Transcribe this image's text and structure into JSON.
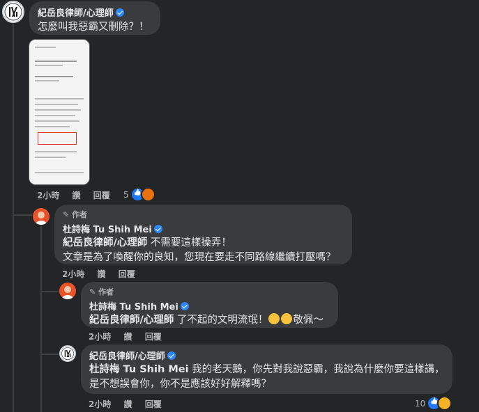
{
  "thread": {
    "top_comment": {
      "name": "紀岳良律師/心理師",
      "text": "怎麼叫我惡霸又刪除？！",
      "time": "2小時",
      "like_label": "讚",
      "reply_label": "回覆",
      "reaction_count": "5"
    },
    "reply1": {
      "author_badge": "作者",
      "name": "杜詩梅 Tu Shih Mei",
      "mention": "紀岳良律師/心理師",
      "line1_rest": " 不需要這樣操弄！",
      "line2": "文章是為了喚醒你的良知，您現在要走不同路線繼續打壓嗎？",
      "time": "2小時",
      "like_label": "讚",
      "reply_label": "回覆"
    },
    "reply2": {
      "author_badge": "作者",
      "name": "杜詩梅 Tu Shih Mei",
      "mention": "紀岳良律師/心理師",
      "text_before_emoji": " 了不起的文明流氓！",
      "text_after_emoji": "敬佩～",
      "time": "2小時",
      "like_label": "讚",
      "reply_label": "回覆"
    },
    "reply3": {
      "name": "紀岳良律師/心理師",
      "mention": "杜詩梅 Tu Shih Mei",
      "line1_rest": " 我的老天鵝，你先對我說惡霸，我說為什麼你要這樣講，",
      "line2": "是不想誤會你，你不是應該好好解釋嗎？",
      "time": "2小時",
      "like_label": "讚",
      "reply_label": "回覆",
      "reaction_count": "10"
    }
  },
  "colors": {
    "background": "#242526",
    "bubble": "#3a3b3c",
    "verified": "#2d88ff",
    "meta_text": "#b0b3b8"
  }
}
